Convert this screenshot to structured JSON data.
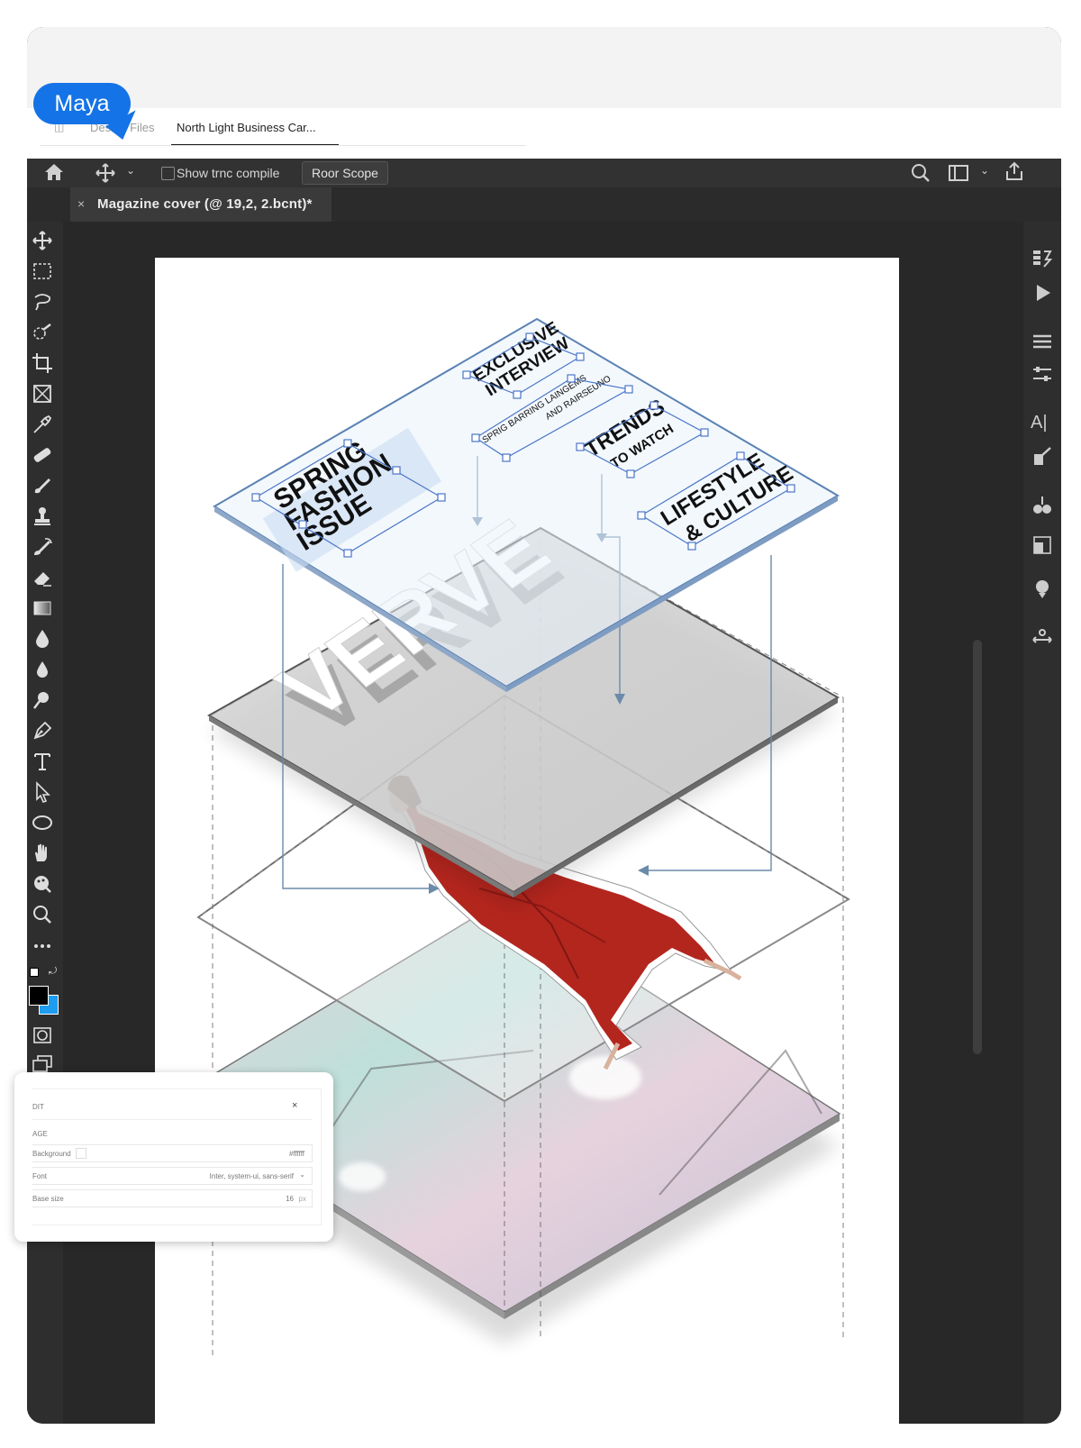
{
  "tabs": {
    "design_files": "Design Files",
    "active": "North Light Business Car..."
  },
  "cursor_label": "Maya",
  "options_bar": {
    "checkbox_label": "Show trnc compile",
    "button_label": "Roor Scope"
  },
  "document": {
    "tab_close": "×",
    "tab_title": "Magazine cover (@ 19,2, 2.bcnt)*"
  },
  "artwork": {
    "masthead": "VERVE",
    "spring_line1": "SPRING",
    "spring_line2": "FASHION",
    "spring_line3": "ISSUE",
    "exclusive_line1": "EXCLUSIVE",
    "exclusive_line2": "INTERVIEW",
    "small_line1": "SPRIG BARRING LAINGEMS",
    "small_line2": "AND RAIRSEUNO",
    "trends_line1": "TRENDS",
    "trends_line2": "TO WATCH",
    "lifestyle_line1": "LIFESTYLE",
    "lifestyle_line2": "& CULTURE"
  },
  "right_panel": {
    "type_icon_text": "A|"
  },
  "edit_panel": {
    "header": "DIT",
    "close": "×",
    "section": "AGE",
    "background_label": "Background",
    "background_value": "#ffffff",
    "font_label": "Font",
    "font_value": "Inter, system-ui, sans-serif",
    "font_chevron": "⌄",
    "size_label": "Base size",
    "size_value": "16",
    "size_unit": "px"
  },
  "colors": {
    "accent": "#1473e6",
    "foreground_swatch": "#000000",
    "background_swatch": "#1e9cf0",
    "coat": "#b3261e"
  }
}
